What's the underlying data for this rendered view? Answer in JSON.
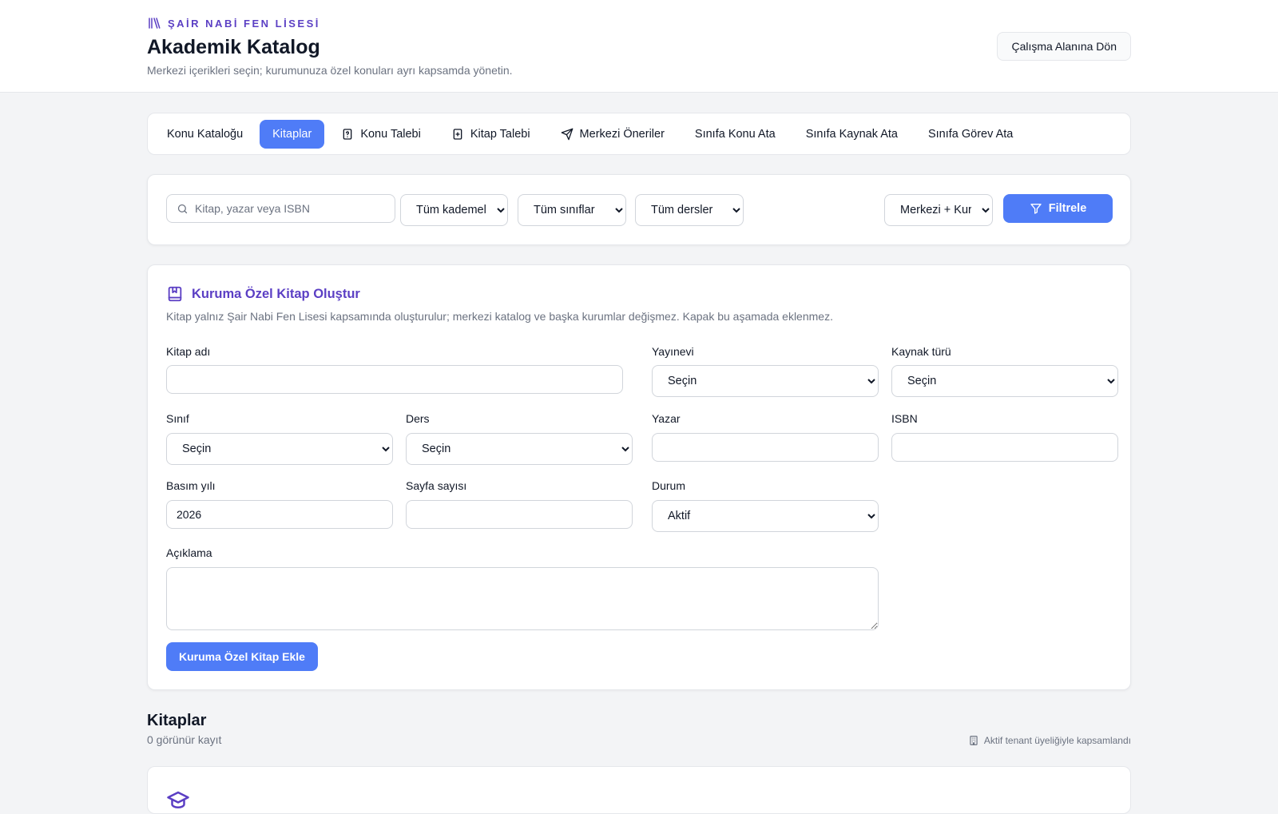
{
  "header": {
    "brand": "ŞAİR NABİ FEN LİSESİ",
    "title": "Akademik Katalog",
    "subtitle": "Merkezi içerikleri seçin; kurumunuza özel konuları ayrı kapsamda yönetin.",
    "back_button": "Çalışma Alanına Dön"
  },
  "tabs": [
    {
      "label": "Konu Kataloğu",
      "icon": ""
    },
    {
      "label": "Kitaplar",
      "icon": "",
      "active": true
    },
    {
      "label": "Konu Talebi",
      "icon": "question-file-icon"
    },
    {
      "label": "Kitap Talebi",
      "icon": "plus-file-icon"
    },
    {
      "label": "Merkezi Öneriler",
      "icon": "send-icon"
    },
    {
      "label": "Sınıfa Konu Ata",
      "icon": ""
    },
    {
      "label": "Sınıfa Kaynak Ata",
      "icon": ""
    },
    {
      "label": "Sınıfa Görev Ata",
      "icon": ""
    }
  ],
  "filters": {
    "search_placeholder": "Kitap, yazar veya ISBN",
    "level": "Tüm kademeler",
    "class": "Tüm sınıflar",
    "subject": "Tüm dersler",
    "scope": "Merkezi + Kurum",
    "button": "Filtrele"
  },
  "create": {
    "title": "Kuruma Özel Kitap Oluştur",
    "description": "Kitap yalnız Şair Nabi Fen Lisesi kapsamında oluşturulur; merkezi katalog ve başka kurumlar değişmez. Kapak bu aşamada eklenmez.",
    "labels": {
      "book_name": "Kitap adı",
      "publisher": "Yayınevi",
      "source_type": "Kaynak türü",
      "class": "Sınıf",
      "subject": "Ders",
      "author": "Yazar",
      "isbn": "ISBN",
      "year": "Basım yılı",
      "pages": "Sayfa sayısı",
      "status": "Durum",
      "description": "Açıklama"
    },
    "values": {
      "publisher": "Seçin",
      "source_type": "Seçin",
      "class": "Seçin",
      "subject": "Seçin",
      "year": "2026",
      "status": "Aktif"
    },
    "submit": "Kuruma Özel Kitap Ekle"
  },
  "list": {
    "title": "Kitaplar",
    "count": "0 görünür kayıt",
    "scope_note": "Aktif tenant üyeliğiyle kapsamlandı"
  },
  "colors": {
    "accent": "#4f7cf7",
    "brand": "#5b3fc4"
  }
}
